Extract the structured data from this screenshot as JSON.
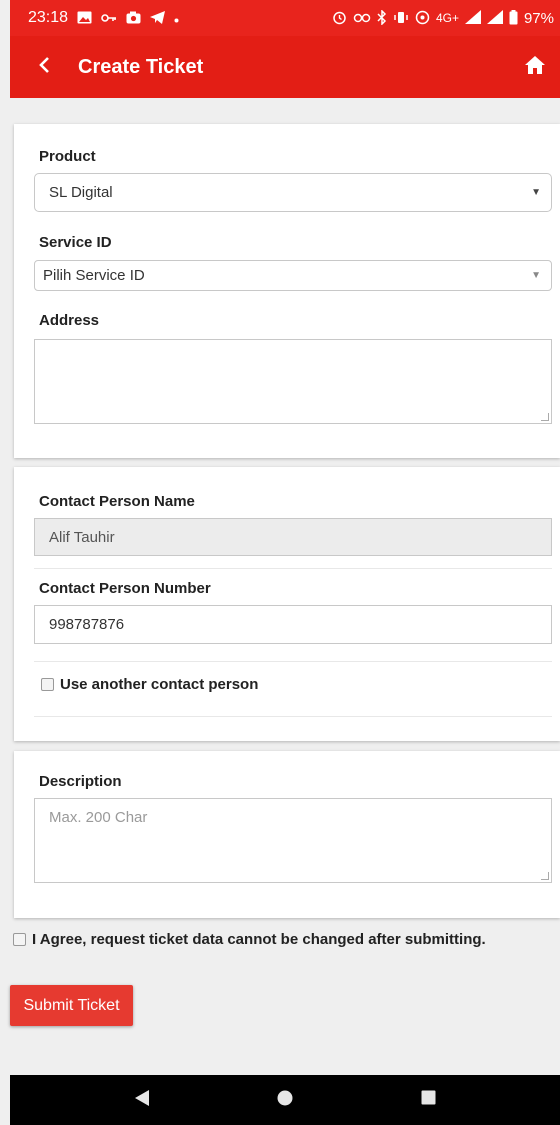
{
  "status_bar": {
    "time": "23:18",
    "network": "4G+",
    "battery": "97%",
    "left_icons": [
      "image-icon",
      "key-icon",
      "camera-icon",
      "telegram-icon",
      "dot-icon"
    ],
    "right_icons": [
      "alarm-icon",
      "vpn-key-icon",
      "bluetooth-icon",
      "vibrate-icon",
      "hotspot-icon",
      "signal-icon",
      "signal-icon",
      "battery-icon"
    ]
  },
  "app_bar": {
    "title": "Create Ticket",
    "back_icon": "chevron-left-icon",
    "home_icon": "home-icon",
    "background_color": "#e31e15"
  },
  "section_product": {
    "product_label": "Product",
    "product_value": "SL Digital",
    "service_label": "Service ID",
    "service_value": "Pilih Service ID",
    "address_label": "Address",
    "address_value": ""
  },
  "section_contact": {
    "name_label": "Contact Person Name",
    "name_value": "Alif Tauhir",
    "number_label": "Contact Person Number",
    "number_value": "998787876",
    "another_contact_label": "Use another contact person"
  },
  "section_description": {
    "label": "Description",
    "placeholder": "Max. 200 Char"
  },
  "agreement": {
    "label": "I Agree, request ticket data cannot be changed after submitting."
  },
  "submit": {
    "label": "Submit Ticket",
    "color": "#e63a30"
  },
  "nav_bar": {
    "icons": [
      "back-triangle-icon",
      "home-circle-icon",
      "recents-square-icon"
    ]
  }
}
